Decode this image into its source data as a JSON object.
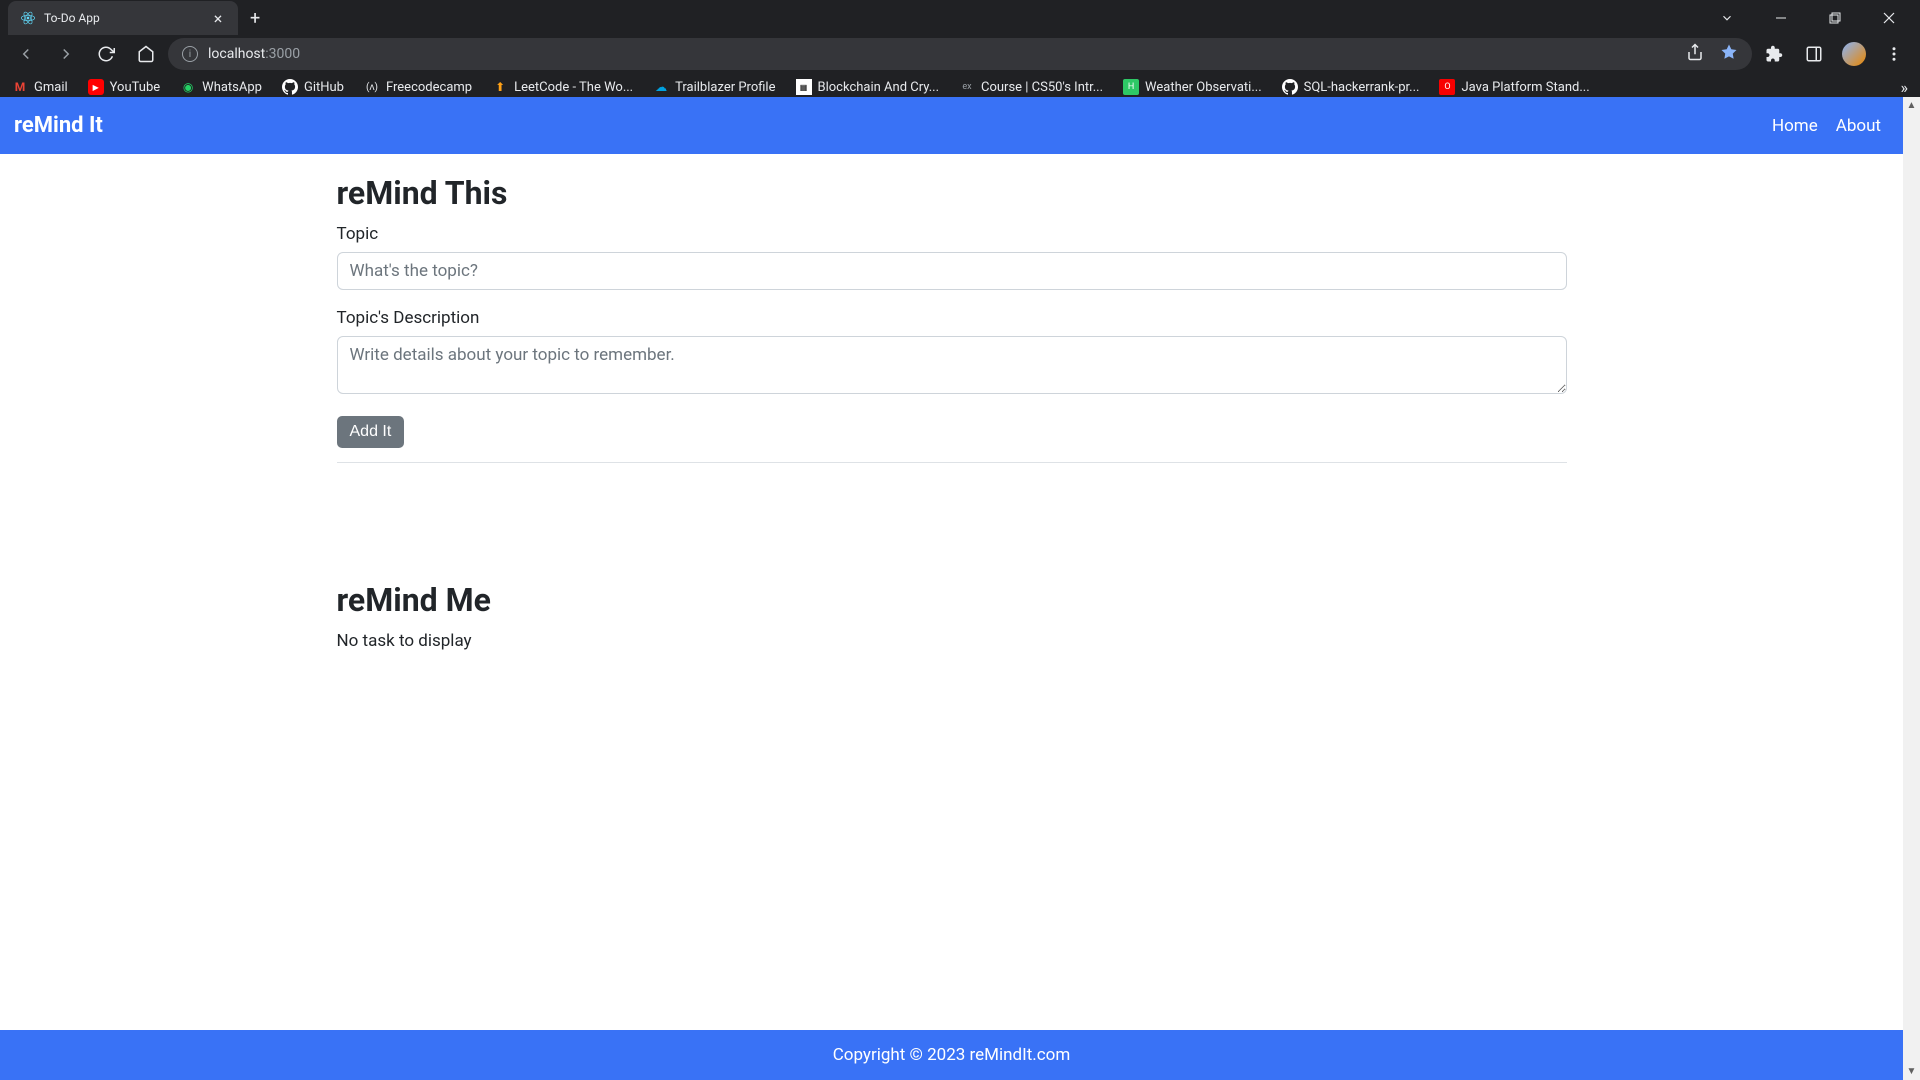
{
  "browser": {
    "tab_title": "To-Do App",
    "url_host": "localhost",
    "url_path": ":3000",
    "bookmarks": [
      {
        "label": "Gmail",
        "icon": "M",
        "color": "#ea4335"
      },
      {
        "label": "YouTube",
        "icon": "▶",
        "color": "#ff0000"
      },
      {
        "label": "WhatsApp",
        "icon": "◉",
        "color": "#25d366"
      },
      {
        "label": "GitHub",
        "icon": "◯",
        "color": "#fff"
      },
      {
        "label": "Freecodecamp",
        "icon": "(ʌ)",
        "color": "#fff"
      },
      {
        "label": "LeetCode - The Wo...",
        "icon": "⬆",
        "color": "#ffa116"
      },
      {
        "label": "Trailblazer Profile",
        "icon": "☁",
        "color": "#00a1e0"
      },
      {
        "label": "Blockchain And Cry...",
        "icon": "▦",
        "color": "#fff"
      },
      {
        "label": "Course | CS50's Intr...",
        "icon": "ex",
        "color": "#9aa0a6"
      },
      {
        "label": "Weather Observati...",
        "icon": "H",
        "color": "#2ec866"
      },
      {
        "label": "SQL-hackerrank-pr...",
        "icon": "◯",
        "color": "#fff"
      },
      {
        "label": "Java Platform Stand...",
        "icon": "O",
        "color": "#f80000"
      }
    ]
  },
  "navbar": {
    "brand": "reMind It",
    "links": [
      "Home",
      "About"
    ]
  },
  "form": {
    "heading": "reMind This",
    "topic_label": "Topic",
    "topic_placeholder": "What's the topic?",
    "topic_value": "",
    "desc_label": "Topic's Description",
    "desc_placeholder": "Write details about your topic to remember.",
    "desc_value": "",
    "submit_label": "Add It"
  },
  "list": {
    "heading": "reMind Me",
    "empty": "No task to display"
  },
  "footer": {
    "text": "Copyright © 2023 reMindIt.com"
  }
}
